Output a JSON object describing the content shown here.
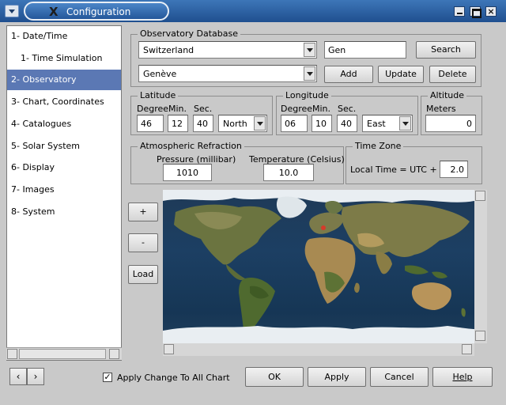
{
  "window": {
    "title": "Configuration",
    "close_glyph": "×"
  },
  "tree": {
    "items": [
      {
        "label": "1- Date/Time"
      },
      {
        "label": "1- Time Simulation"
      },
      {
        "label": "2- Observatory"
      },
      {
        "label": "3- Chart, Coordinates"
      },
      {
        "label": "4- Catalogues"
      },
      {
        "label": "5- Solar System"
      },
      {
        "label": "6- Display"
      },
      {
        "label": "7- Images"
      },
      {
        "label": "8- System"
      }
    ],
    "selected_index": 2
  },
  "observatory_db": {
    "title": "Observatory Database",
    "country": "Switzerland",
    "search_value": "Gen",
    "city": "Genève",
    "search_button": "Search",
    "add_button": "Add",
    "update_button": "Update",
    "delete_button": "Delete"
  },
  "latitude": {
    "title": "Latitude",
    "degree_label": "Degree",
    "min_label": "Min.",
    "sec_label": "Sec.",
    "degree": "46",
    "min": "12",
    "sec": "40",
    "hemisphere": "North"
  },
  "longitude": {
    "title": "Longitude",
    "degree_label": "Degree",
    "min_label": "Min.",
    "sec_label": "Sec.",
    "degree": "06",
    "min": "10",
    "sec": "40",
    "direction": "East"
  },
  "altitude": {
    "title": "Altitude",
    "meters_label": "Meters",
    "meters": "0"
  },
  "refraction": {
    "title": "Atmospheric Refraction",
    "pressure_label": "Pressure (millibar)",
    "pressure": "1010",
    "temperature_label": "Temperature (Celsius)",
    "temperature": "10.0"
  },
  "timezone": {
    "title": "Time Zone",
    "label": "Local Time =  UTC +",
    "value": "2.0"
  },
  "map_controls": {
    "zoom_in": "+",
    "zoom_out": "-",
    "load": "Load"
  },
  "bottom": {
    "prev": "‹",
    "next": "›",
    "apply_all_label": "Apply Change To All Chart",
    "apply_all_checked": true,
    "check_glyph": "✓",
    "ok": "OK",
    "apply": "Apply",
    "cancel": "Cancel",
    "help": "Help"
  }
}
